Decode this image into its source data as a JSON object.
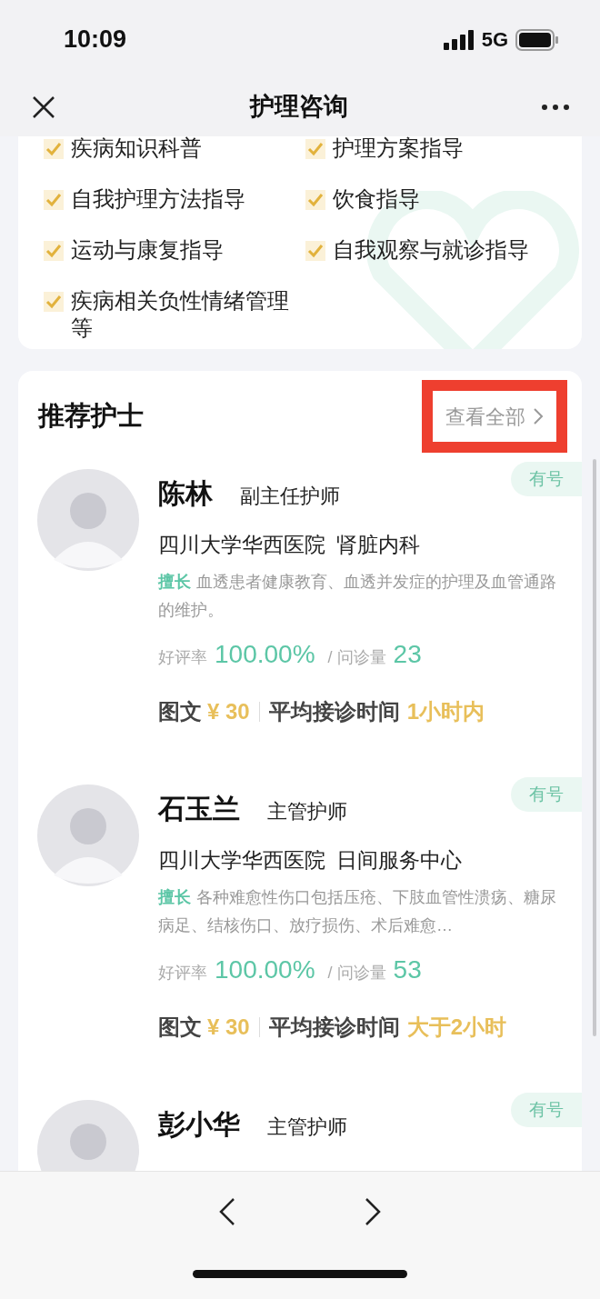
{
  "status_bar": {
    "time": "10:09",
    "network": "5G"
  },
  "header": {
    "title": "护理咨询"
  },
  "checklist": [
    {
      "label": "疾病知识科普",
      "checked": true
    },
    {
      "label": "护理方案指导",
      "checked": true
    },
    {
      "label": "自我护理方法指导",
      "checked": true
    },
    {
      "label": "饮食指导",
      "checked": true
    },
    {
      "label": "运动与康复指导",
      "checked": true
    },
    {
      "label": "自我观察与就诊指导",
      "checked": true
    },
    {
      "label": "疾病相关负性情绪管理等",
      "checked": true
    }
  ],
  "recommended": {
    "title": "推荐护士",
    "see_all": {
      "label": "查看全部",
      "highlighted": true
    }
  },
  "nurses": [
    {
      "name": "陈林",
      "title": "副主任护师",
      "badge": "有号",
      "hospital": "四川大学华西医院",
      "department": "肾脏内科",
      "specialty_label": "擅长",
      "specialty": "血透患者健康教育、血透并发症的护理及血管通路的维护。",
      "rating_label": "好评率",
      "rating": "100.00%",
      "consult_label": "/ 问诊量",
      "consults": "23",
      "service": "图文",
      "price": "¥ 30",
      "wait_label": "平均接诊时间",
      "wait": "1小时内"
    },
    {
      "name": "石玉兰",
      "title": "主管护师",
      "badge": "有号",
      "hospital": "四川大学华西医院",
      "department": "日间服务中心",
      "specialty_label": "擅长",
      "specialty": "各种难愈性伤口包括压疮、下肢血管性溃疡、糖尿病足、结核伤口、放疗损伤、术后难愈…",
      "rating_label": "好评率",
      "rating": "100.00%",
      "consult_label": "/ 问诊量",
      "consults": "53",
      "service": "图文",
      "price": "¥ 30",
      "wait_label": "平均接诊时间",
      "wait": "大于2小时"
    },
    {
      "name": "彭小华",
      "title": "主管护师",
      "badge": "有号"
    }
  ]
}
